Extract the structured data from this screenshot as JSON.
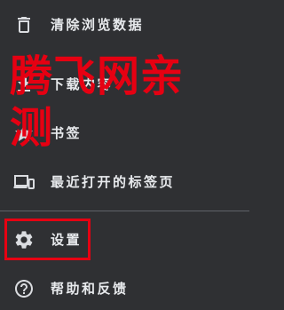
{
  "menu": {
    "items": [
      {
        "label": "清除浏览数据",
        "icon": "trash-icon"
      },
      {
        "label": "下载内容",
        "icon": "download-icon"
      },
      {
        "label": "书签",
        "icon": "star-icon"
      },
      {
        "label": "最近打开的标签页",
        "icon": "devices-icon"
      },
      {
        "label": "设置",
        "icon": "gear-icon"
      },
      {
        "label": "帮助和反馈",
        "icon": "help-icon"
      }
    ]
  },
  "watermark": {
    "line1": "腾飞网亲",
    "line2": "测"
  },
  "colors": {
    "background": "#2f3033",
    "text": "#e8eaed",
    "icon": "#dadce0",
    "divider": "#5f6368",
    "watermark": "#e60012",
    "highlight": "#e60012"
  }
}
